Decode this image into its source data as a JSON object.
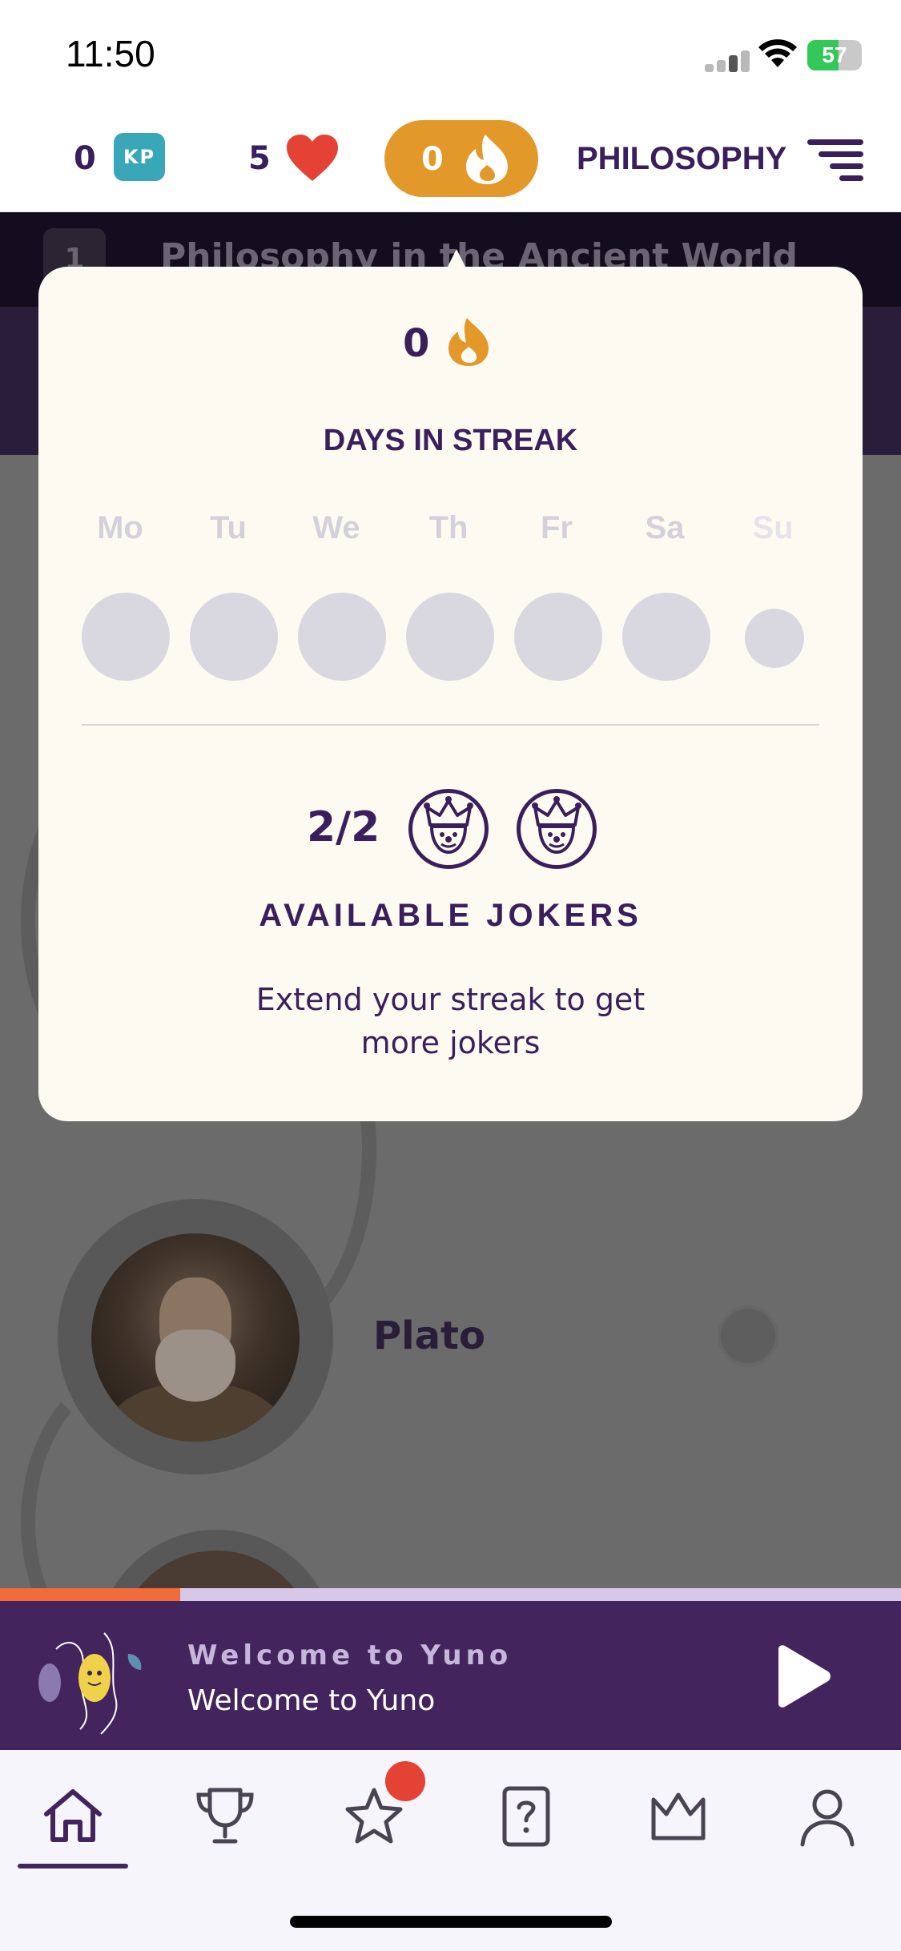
{
  "status_bar": {
    "time": "11:50",
    "battery": "57",
    "battery_level": 0.57
  },
  "top_bar": {
    "kp_count": "0",
    "kp_label": "KP",
    "hearts_count": "5",
    "streak_count": "0",
    "course_title": "PHILOSOPHY"
  },
  "chapter": {
    "number": "1",
    "title": "Philosophy in the Ancient World"
  },
  "lesson": {
    "name": "Plato"
  },
  "streak_popover": {
    "streak_count": "0",
    "title": "DAYS IN STREAK",
    "days": [
      "Mo",
      "Tu",
      "We",
      "Th",
      "Fr",
      "Sa",
      "Su"
    ],
    "jokers_count": "2/2",
    "jokers_title": "AVAILABLE JOKERS",
    "jokers_description": "Extend your streak to get more jokers"
  },
  "player": {
    "subtitle": "Welcome to Yuno",
    "title": "Welcome to Yuno",
    "progress": 0.2
  },
  "tabs": [
    {
      "icon": "home-icon",
      "active": true
    },
    {
      "icon": "trophy-icon",
      "active": false
    },
    {
      "icon": "star-icon",
      "active": false,
      "badge": true
    },
    {
      "icon": "quiz-icon",
      "active": false
    },
    {
      "icon": "crown-icon",
      "active": false
    },
    {
      "icon": "profile-icon",
      "active": false
    }
  ],
  "colors": {
    "purple": "#3b1f5c",
    "streak_orange": "#e2992a",
    "kp_teal": "#3aa7b8",
    "heart_red": "#e34234",
    "popover_bg": "#fdfbf1",
    "progress_orange": "#f26b3a"
  }
}
